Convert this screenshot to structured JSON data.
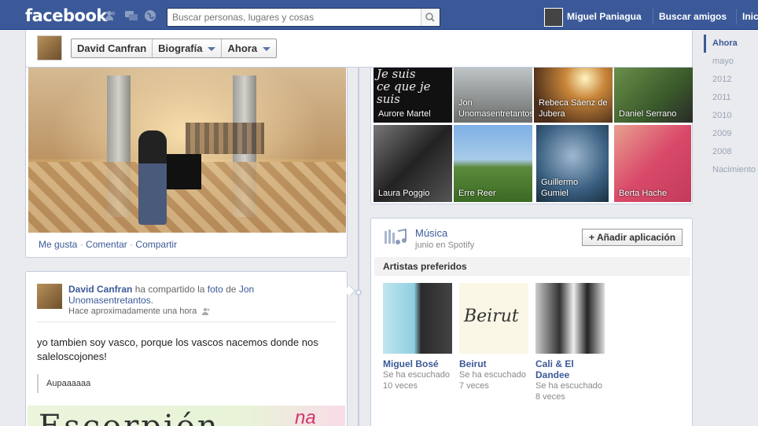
{
  "topbar": {
    "logo": "facebook",
    "search_placeholder": "Buscar personas, lugares y cosas",
    "user_name": "Miguel Paniagua",
    "find_friends": "Buscar amigos",
    "home": "Inic"
  },
  "profile": {
    "name": "David Canfran",
    "tab_biography": "Biografía",
    "tab_now": "Ahora"
  },
  "timeline_nav": [
    "Ahora",
    "mayo",
    "2012",
    "2011",
    "2010",
    "2009",
    "2008",
    "Nacimiento"
  ],
  "photo_actions": {
    "like": "Me gusta",
    "comment": "Comentar",
    "share": "Compartir",
    "sep": "·"
  },
  "post": {
    "author": "David Canfran",
    "shared_text": "ha compartido la",
    "object": "foto",
    "of_text": "de",
    "owner": "Jon Unomasentretantos",
    "period": ".",
    "time": "Hace aproximadamente una hora",
    "text": "yo tambien soy vasco, porque los vascos nacemos donde nos saleloscojones!",
    "quote": "Aupaaaaaa",
    "image_text": "Escorpión",
    "image_text_right": "na"
  },
  "friends": [
    {
      "name": "Aurore Martel",
      "overlay": "Je suis ce que je suis"
    },
    {
      "name": "Jon Unomasentretantos"
    },
    {
      "name": "Rebeca Sáenz de Jubera"
    },
    {
      "name": "Daniel Serrano"
    },
    {
      "name": "Laura Poggio"
    },
    {
      "name": "Erre Reer"
    },
    {
      "name": "Guillermo Gumiel"
    },
    {
      "name": "Berta Hache"
    }
  ],
  "music": {
    "title": "Música",
    "subtitle": "junio en Spotify",
    "add_app": "Añadir aplicación",
    "artists_header": "Artistas preferidos",
    "artists": [
      {
        "name": "Miguel Bosé",
        "meta": "Se ha escuchado 10 veces"
      },
      {
        "name": "Beirut",
        "meta": "Se ha escuchado 7 veces",
        "logo_text": "Beirut"
      },
      {
        "name": "Cali & El Dandee",
        "meta": "Se ha escuchado 8 veces"
      }
    ]
  },
  "colors": {
    "brand": "#3b5998",
    "link": "#3b5998",
    "background": "#e9ebee"
  }
}
